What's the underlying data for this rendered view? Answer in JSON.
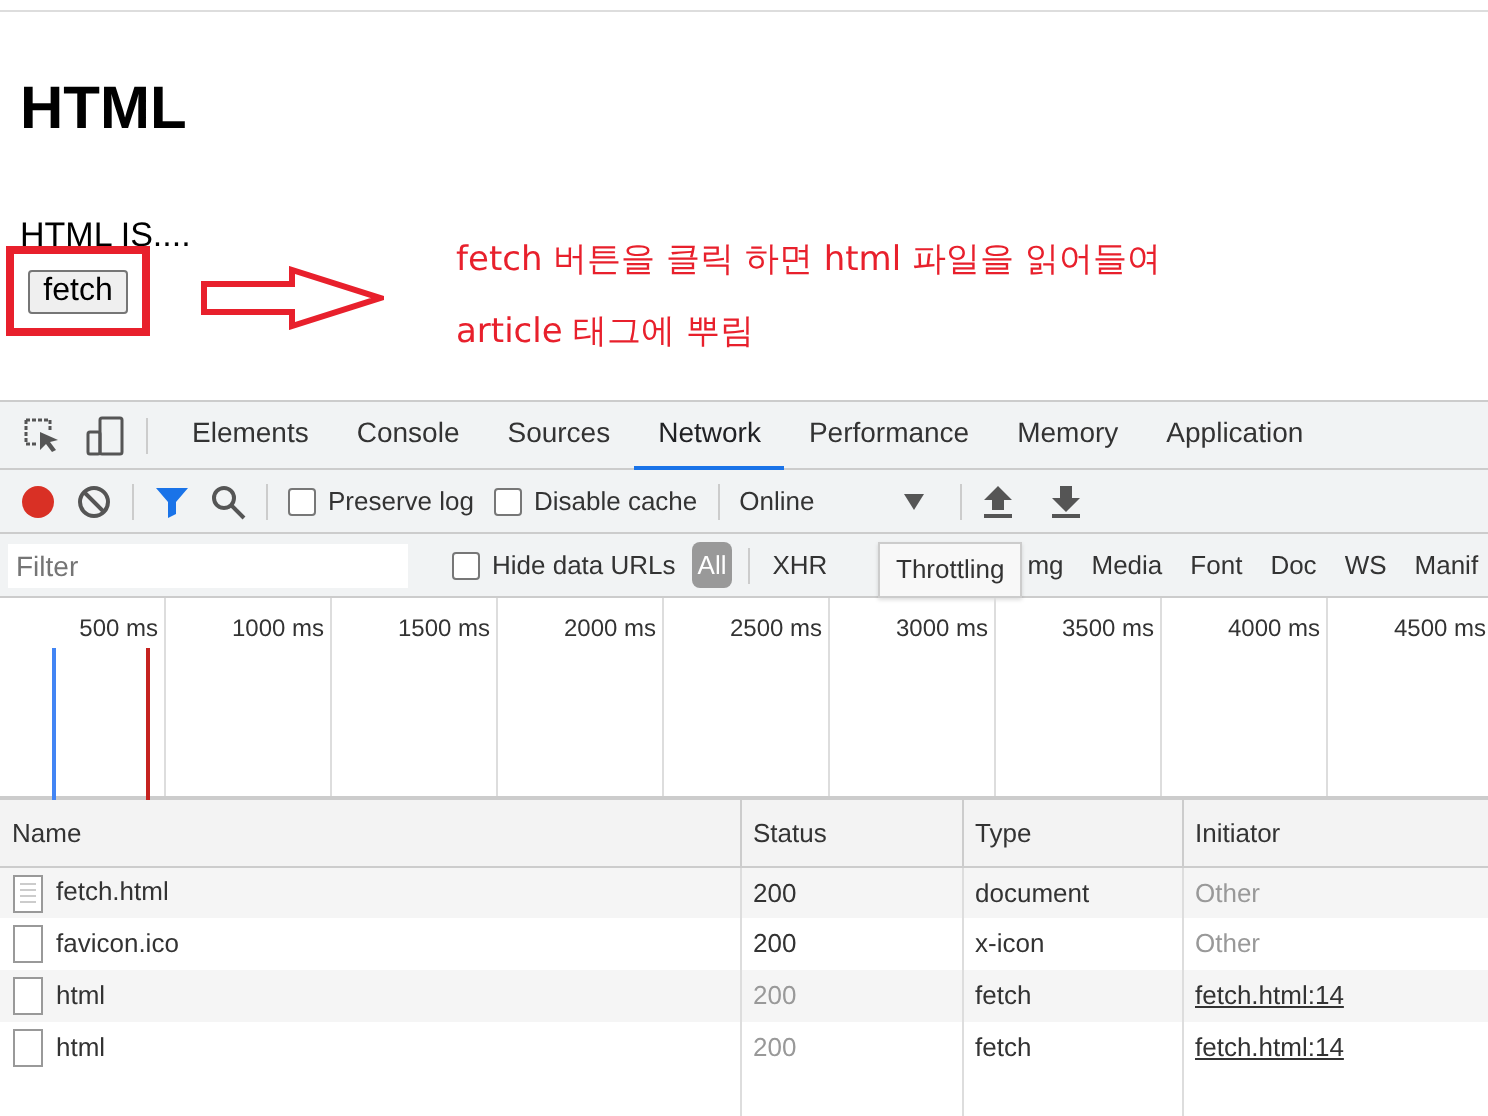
{
  "page": {
    "heading": "HTML",
    "paragraph": "HTML IS....",
    "button": "fetch",
    "annotation_lines": [
      "fetch 버튼을 클릭 하면 html 파일을 읽어들여",
      "article 태그에 뿌림"
    ]
  },
  "devtools": {
    "tabs": [
      {
        "label": "Elements",
        "selected": false
      },
      {
        "label": "Console",
        "selected": false
      },
      {
        "label": "Sources",
        "selected": false
      },
      {
        "label": "Network",
        "selected": true
      },
      {
        "label": "Performance",
        "selected": false
      },
      {
        "label": "Memory",
        "selected": false
      },
      {
        "label": "Application",
        "selected": false
      }
    ],
    "toolbar": {
      "recording": true,
      "filter_active": true,
      "preserve_log": {
        "label": "Preserve log",
        "checked": false
      },
      "disable_cache": {
        "label": "Disable cache",
        "checked": false
      },
      "throttling": "Online"
    },
    "filter_bar": {
      "placeholder": "Filter",
      "hide_data_urls": {
        "label": "Hide data URLs",
        "checked": false
      },
      "types": [
        {
          "label": "All",
          "selected": true
        },
        {
          "label": "XHR",
          "selected": false
        },
        {
          "label": "mg",
          "selected": false
        },
        {
          "label": "Media",
          "selected": false
        },
        {
          "label": "Font",
          "selected": false
        },
        {
          "label": "Doc",
          "selected": false
        },
        {
          "label": "WS",
          "selected": false
        },
        {
          "label": "Manif",
          "selected": false
        }
      ],
      "tooltip": "Throttling"
    },
    "timeline": {
      "ticks": [
        "500 ms",
        "1000 ms",
        "1500 ms",
        "2000 ms",
        "2500 ms",
        "3000 ms",
        "3500 ms",
        "4000 ms",
        "4500 ms"
      ]
    },
    "table": {
      "columns": [
        "Name",
        "Status",
        "Type",
        "Initiator"
      ],
      "rows": [
        {
          "kind": "document",
          "name": "fetch.html",
          "status": "200",
          "status_dimmed": false,
          "resource_type": "document",
          "initiator": "Other",
          "initiator_is_link": false
        },
        {
          "kind": "blank",
          "name": "favicon.ico",
          "status": "200",
          "status_dimmed": false,
          "resource_type": "x-icon",
          "initiator": "Other",
          "initiator_is_link": false
        },
        {
          "kind": "blank",
          "name": "html",
          "status": "200",
          "status_dimmed": true,
          "resource_type": "fetch",
          "initiator": "fetch.html:14",
          "initiator_is_link": true
        },
        {
          "kind": "blank",
          "name": "html",
          "status": "200",
          "status_dimmed": true,
          "resource_type": "fetch",
          "initiator": "fetch.html:14",
          "initiator_is_link": true
        }
      ]
    }
  }
}
